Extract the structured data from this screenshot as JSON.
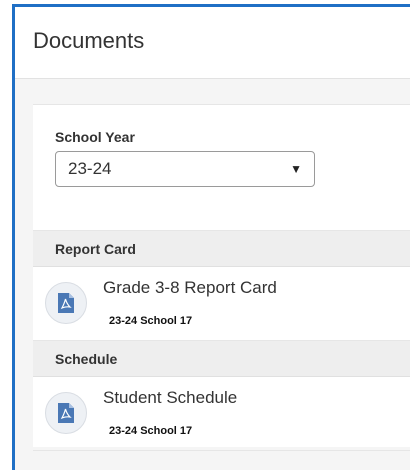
{
  "header": {
    "title": "Documents"
  },
  "school_year": {
    "label": "School Year",
    "selected": "23-24"
  },
  "sections": [
    {
      "title": "Report Card",
      "documents": [
        {
          "title": "Grade 3-8 Report Card",
          "subtitle": "23-24 School 17",
          "icon": "pdf-icon"
        }
      ]
    },
    {
      "title": "Schedule",
      "documents": [
        {
          "title": "Student Schedule",
          "subtitle": "23-24 School 17",
          "icon": "pdf-icon"
        }
      ]
    }
  ],
  "colors": {
    "accent_border": "#1f6fc5",
    "pdf_icon": "#4a78b5"
  }
}
